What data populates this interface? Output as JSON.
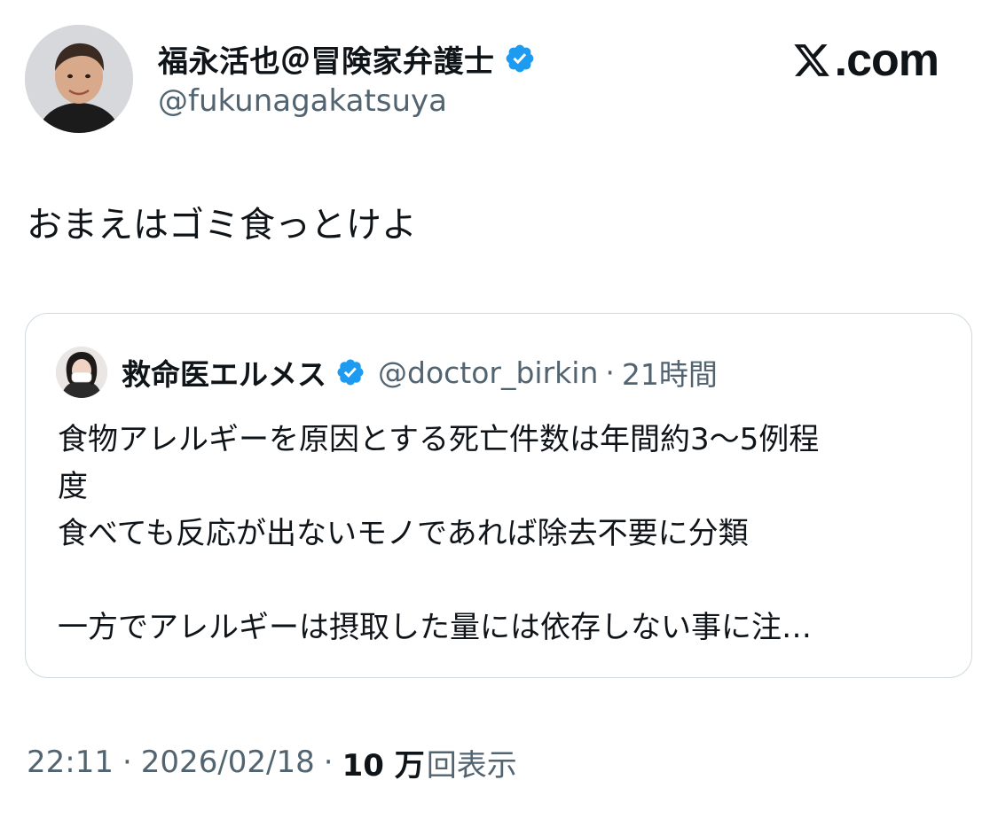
{
  "post": {
    "author": {
      "display_name": "福永活也＠冒険家弁護士",
      "handle": "@fukunagakatsuya",
      "verified": true,
      "avatar_icon": "profile-photo"
    },
    "brand": {
      "icon": "x-logo-icon",
      "text": ".com"
    },
    "text": "おまえはゴミ食っとけよ",
    "quoted": {
      "author": {
        "display_name": "救命医エルメス",
        "handle": "@doctor_birkin",
        "verified": true,
        "avatar_icon": "profile-photo"
      },
      "separator": "·",
      "time": "21時間",
      "lines": [
        "食物アレルギーを原因とする死亡件数は年間約3〜5例程",
        "度",
        "食べても反応が出ないモノであれば除去不要に分類",
        "",
        "一方でアレルギーは摂取した量には依存しない事に注…"
      ]
    },
    "meta": {
      "time": "22:11",
      "separator": "·",
      "date": "2026/02/18",
      "views_count": "10 万",
      "views_label": "回表示"
    }
  },
  "colors": {
    "text_primary": "#0f1419",
    "text_secondary": "#536471",
    "border": "#cfd9de",
    "verified_blue": "#1d9bf0"
  }
}
